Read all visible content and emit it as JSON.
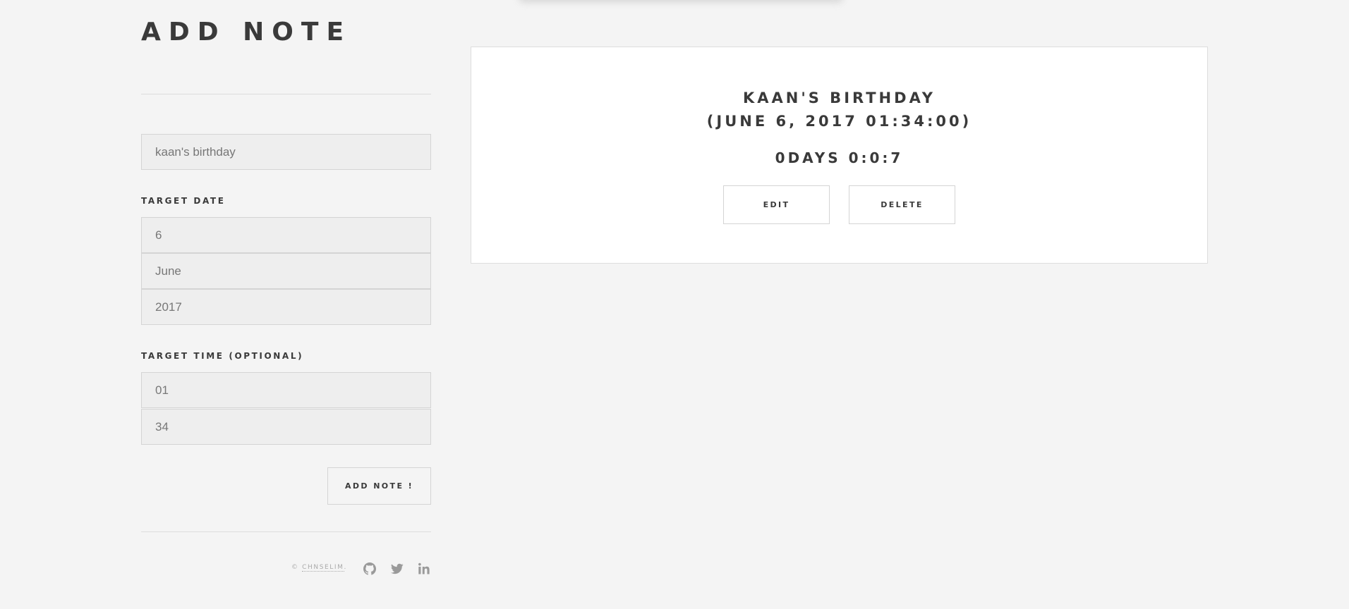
{
  "page": {
    "title": "ADD NOTE"
  },
  "form": {
    "name_value": "kaan's birthday",
    "target_date_label": "TARGET DATE",
    "day_value": "6",
    "month_value": "June",
    "year_value": "2017",
    "target_time_label": "TARGET TIME (OPTIONAL)",
    "hour_value": "01",
    "minute_value": "34",
    "submit_label": "ADD NOTE !"
  },
  "footer": {
    "copyright_prefix": "© ",
    "copyright_link": "CHNSELIM",
    "copyright_suffix": ".",
    "icons": [
      "github-icon",
      "twitter-icon",
      "linkedin-icon"
    ]
  },
  "note": {
    "title": "KAAN'S BIRTHDAY",
    "date": "(JUNE 6, 2017 01:34:00)",
    "countdown": "0DAYS 0:0:7",
    "edit_label": "EDIT",
    "delete_label": "DELETE"
  },
  "colors": {
    "background": "#f4f4f4",
    "text": "#3a3a3a",
    "field_background": "#eeeeee",
    "muted": "#aaaaaa"
  }
}
